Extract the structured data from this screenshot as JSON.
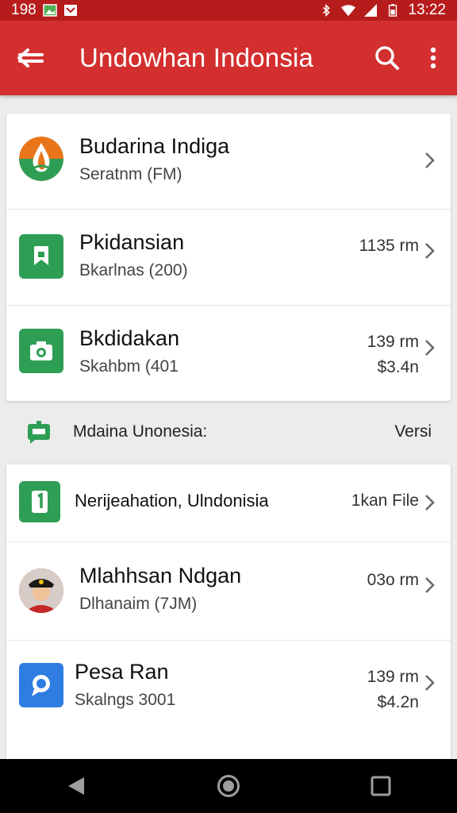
{
  "status_bar": {
    "time_left": "198",
    "time_right": "13:22"
  },
  "app_bar": {
    "title": "Undowhan Indonsia"
  },
  "card1": {
    "items": [
      {
        "title": "Budarina Indiga",
        "subtitle": "Seratnm (FM)",
        "meta1": "",
        "meta2": ""
      },
      {
        "title": "Pkidansian",
        "subtitle": "Bkarlnas (200)",
        "meta1": "1135 rm",
        "meta2": ""
      },
      {
        "title": "Bkdidakan",
        "subtitle": "Skahbm (401",
        "meta1": "139 rm",
        "meta2": "$3.4n"
      }
    ]
  },
  "section": {
    "title": "Mdaina Unonesia:",
    "right": "Versi"
  },
  "card2": {
    "items": [
      {
        "title": "Nerijeahation, Ulndonisia",
        "subtitle": "",
        "meta1": "1kan File",
        "meta2": ""
      },
      {
        "title": "Mlahhsan Ndgan",
        "subtitle": "Dlhanaim (7JM)",
        "meta1": "03o rm",
        "meta2": ""
      },
      {
        "title": "Pesa Ran",
        "subtitle": "Skalngs 3001",
        "meta1": "139 rm",
        "meta2": "$4.2n"
      }
    ]
  },
  "colors": {
    "status_bar": "#b71c1c",
    "app_bar": "#d32f2f",
    "green": "#2e9e55",
    "blue": "#2f7de1",
    "orange": "#e8751a"
  }
}
